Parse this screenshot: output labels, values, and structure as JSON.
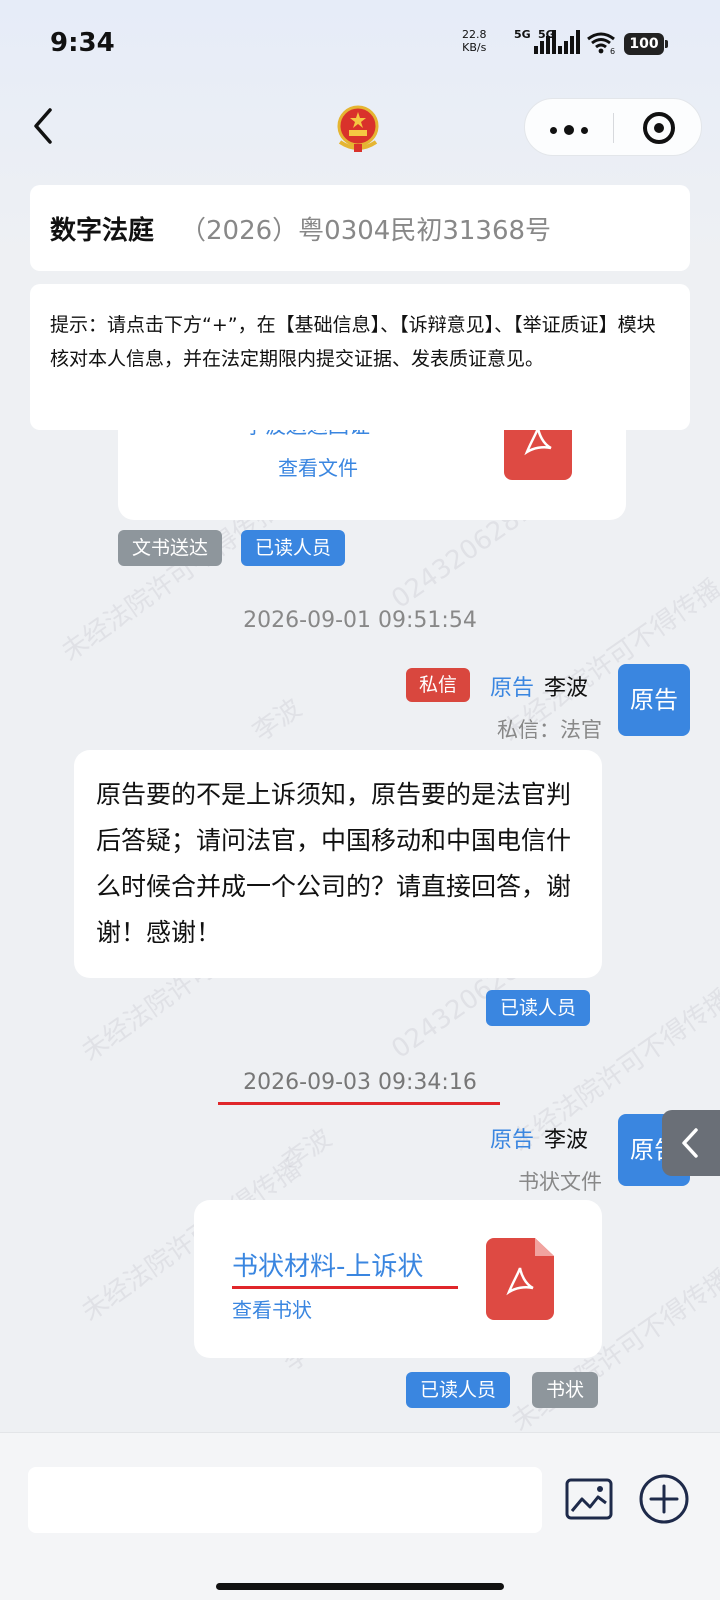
{
  "status_bar": {
    "time": "9:34",
    "net_speed_value": "22.8",
    "net_speed_unit": "KB/s",
    "sim1": "5G",
    "sim2": "5G",
    "wifi_badge": "6",
    "battery": "100"
  },
  "header": {
    "title": "数字法庭",
    "case_number": "（2026）粤0304民初31368号"
  },
  "tip": {
    "text": "提示：请点击下方“+”，在【基础信息】、【诉辩意见】、【举证质证】模块核对本人信息，并在法定期限内提交证据、发表质证意见。"
  },
  "messages": {
    "msg0": {
      "file_title": "李波送达回证",
      "view_link": "查看文件",
      "tags": [
        "文书送达",
        "已读人员"
      ]
    },
    "msg1": {
      "timestamp": "2026-09-01 09:51:54",
      "private_tag": "私信",
      "role": "原告",
      "name": "李波",
      "avatar_text": "原告",
      "sub": "私信：法官",
      "body": "原告要的不是上诉须知，原告要的是法官判后答疑；请问法官，中国移动和中国电信什么时候合并成一个公司的？请直接回答，谢谢！感谢！",
      "tag": "已读人员"
    },
    "msg2": {
      "timestamp": "2026-09-03 09:34:16",
      "role": "原告",
      "name": "李波",
      "avatar_text": "原告",
      "sub": "书状文件",
      "file_title": "书状材料-上诉状",
      "view_link": "查看书状",
      "tags": [
        "已读人员",
        "书状"
      ]
    }
  },
  "watermark": {
    "line1": "未经法院许可不得传播",
    "line2": "0243206281",
    "line3": "李波"
  },
  "colors": {
    "accent": "#3a86e0",
    "danger": "#d9473e",
    "pdf": "#de4a43",
    "underline": "#e0262a"
  }
}
